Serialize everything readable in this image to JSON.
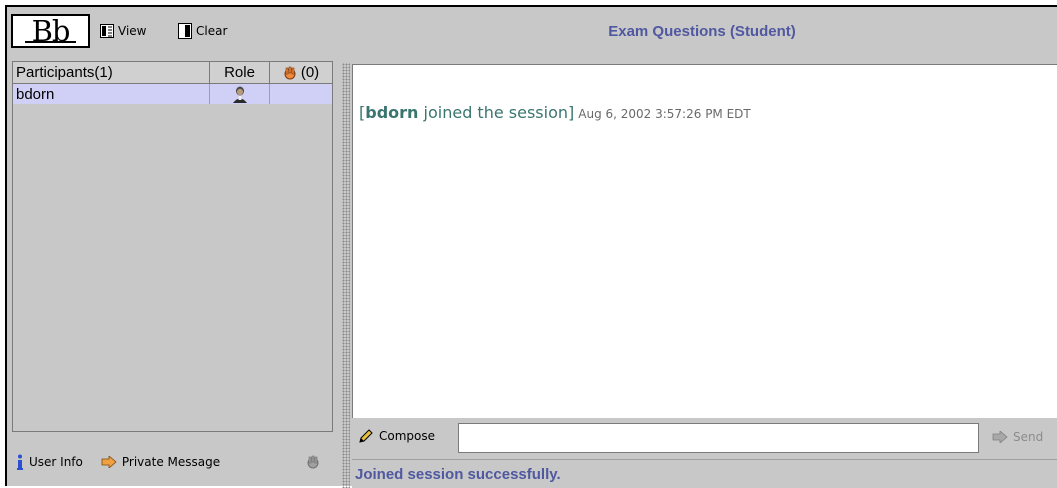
{
  "toolbar": {
    "logo_text": "Bb",
    "view_label": "View",
    "clear_label": "Clear"
  },
  "session_title": "Exam Questions (Student)",
  "participants": {
    "header_participants": "Participants(1)",
    "header_role": "Role",
    "header_hand": "(0)",
    "rows": [
      {
        "name": "bdorn",
        "role_icon": "student-avatar-icon",
        "hand": ""
      }
    ]
  },
  "left_actions": {
    "user_info_label": "User Info",
    "private_message_label": "Private Message"
  },
  "chat": {
    "messages": [
      {
        "open": "[",
        "user": "bdorn",
        "text": " joined the session]",
        "timestamp": "Aug 6, 2002 3:57:26 PM EDT"
      }
    ]
  },
  "compose": {
    "label": "Compose",
    "value": "",
    "send_label": "Send"
  },
  "status": "Joined session successfully.",
  "colors": {
    "title": "#4f58a0",
    "chat_text": "#3a7570",
    "selected_row": "#d0d0f6",
    "panel_bg": "#c8c8c8"
  }
}
